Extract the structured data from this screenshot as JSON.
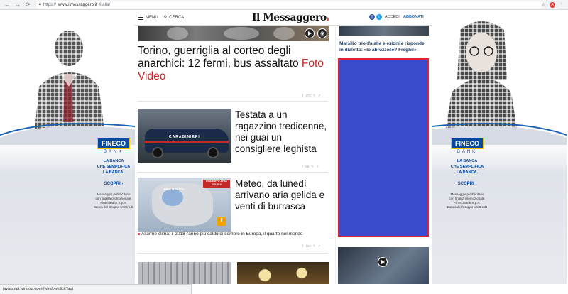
{
  "browser": {
    "url_scheme": "https://",
    "url_host": "www.ilmessaggero.it",
    "url_path": "/italia/",
    "avatar_letter": "A"
  },
  "header": {
    "menu_label": "MENU",
    "search_label": "CERCA",
    "logo": "Il Messaggero",
    "logo_suffix": ".it",
    "login_label": "ACCEDI",
    "subscribe_label": "ABBONATI",
    "facebook": "f",
    "twitter": "t"
  },
  "ads": {
    "brand": "FINECO",
    "bank": "BANK",
    "tagline_1": "LA BANCA",
    "tagline_2": "CHE SEMPLIFICA",
    "tagline_3": "LA BANCA.",
    "cta": "SCOPRI",
    "legal_1": "Messaggio pubblicitario",
    "legal_2": "con finalità promozionale.",
    "legal_3": "FinecoBank S.p.A.",
    "legal_4": "Banca del Gruppo UniCredit"
  },
  "articles": [
    {
      "title": "Torino, guerriglia al corteo degli anarchici: 12 fermi, bus assaltato",
      "tag": "Foto Video",
      "shares": "372"
    },
    {
      "title": "Testata a un ragazzino tredicenne, nei guai un consigliere leghista",
      "shares": "68",
      "image_text": "CARABINIERI"
    },
    {
      "title": "Meteo, da lunedì arrivano aria gelida e venti di burrasca",
      "shares": "150",
      "badge": "IN ARRIVO ARIA GELIDA",
      "map_label": "ARIA GELIDA",
      "related": "Allarme clima: il 2018 l'anno più caldo di sempre in Europa, il quarto nel mondo"
    }
  ],
  "right_column": {
    "headline": "Marsilio trionfa alle elezioni e risponde in dialetto: «Io abruzzese? Freghi!»"
  },
  "status_bar": "javascript:window.open(window.clickTag)",
  "colors": {
    "accent_red": "#c62828",
    "ad_blue": "#3a4ccd",
    "fineco_blue": "#0a4a9e"
  }
}
